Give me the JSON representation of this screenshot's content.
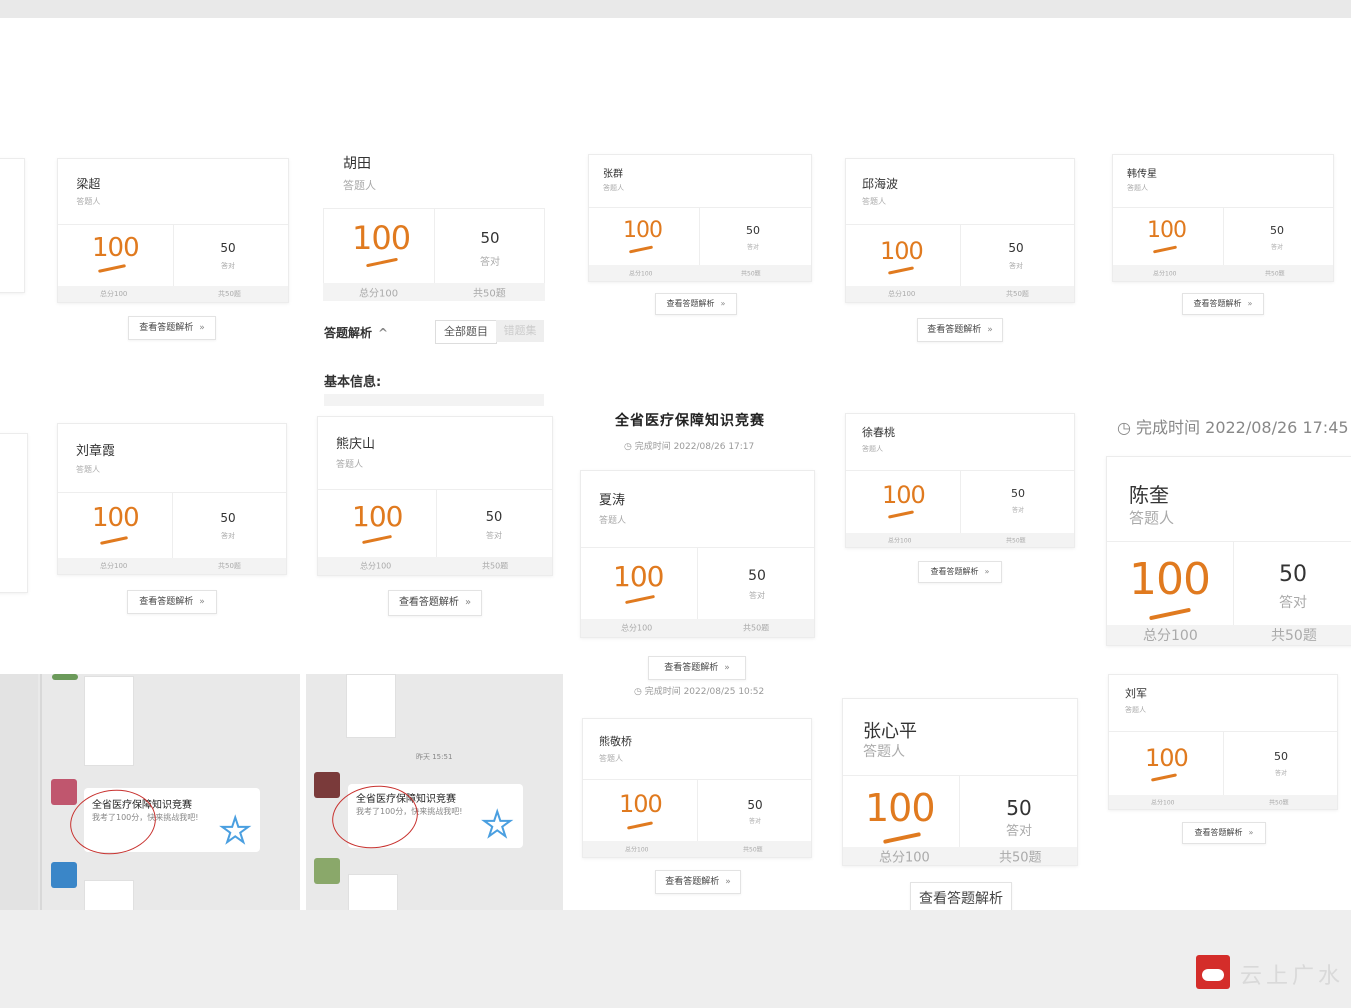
{
  "cards": {
    "liangchao": {
      "name": "梁超",
      "role": "答题人",
      "score": "100",
      "correct": "50",
      "correct_label": "答对",
      "total": "总分100",
      "count": "共50题",
      "button": "查看答题解析"
    },
    "hutian": {
      "name": "胡田",
      "role": "答题人",
      "score": "100",
      "correct": "50",
      "correct_label": "答对",
      "total": "总分100",
      "count": "共50题"
    },
    "zhangqun": {
      "name": "张群",
      "role": "答题人",
      "score": "100",
      "correct": "50",
      "correct_label": "答对",
      "total": "总分100",
      "count": "共50题",
      "button": "查看答题解析"
    },
    "qiuhaibo": {
      "name": "邱海波",
      "role": "答题人",
      "score": "100",
      "correct": "50",
      "correct_label": "答对",
      "total": "总分100",
      "count": "共50题",
      "button": "查看答题解析"
    },
    "hanchuanxing": {
      "name": "韩传星",
      "role": "答题人",
      "score": "100",
      "correct": "50",
      "correct_label": "答对",
      "total": "总分100",
      "count": "共50题",
      "button": "查看答题解析"
    },
    "liuzhangxia": {
      "name": "刘章霞",
      "role": "答题人",
      "score": "100",
      "correct": "50",
      "correct_label": "答对",
      "total": "总分100",
      "count": "共50题",
      "button": "查看答题解析"
    },
    "xiongqingshan": {
      "name": "熊庆山",
      "role": "答题人",
      "score": "100",
      "correct": "50",
      "correct_label": "答对",
      "total": "总分100",
      "count": "共50题",
      "button": "查看答题解析"
    },
    "xiatao": {
      "name": "夏涛",
      "role": "答题人",
      "score": "100",
      "correct": "50",
      "correct_label": "答对",
      "total": "总分100",
      "count": "共50题",
      "button": "查看答题解析"
    },
    "xuchuntao": {
      "name": "徐春桃",
      "role": "答题人",
      "score": "100",
      "correct": "50",
      "correct_label": "答对",
      "total": "总分100",
      "count": "共50题",
      "button": "查看答题解析"
    },
    "chenkui": {
      "name": "陈奎",
      "role": "答题人",
      "score": "100",
      "correct": "50",
      "correct_label": "答对",
      "total": "总分100",
      "count": "共50题"
    },
    "xiongjingqiao": {
      "name": "熊敬桥",
      "role": "答题人",
      "score": "100",
      "correct": "50",
      "correct_label": "答对",
      "total": "总分100",
      "count": "共50题",
      "button": "查看答题解析"
    },
    "zhangxinping": {
      "name": "张心平",
      "role": "答题人",
      "score": "100",
      "correct": "50",
      "correct_label": "答对",
      "total": "总分100",
      "count": "共50题",
      "button": "查看答题解析"
    },
    "liujun": {
      "name": "刘军",
      "role": "答题人",
      "score": "100",
      "correct": "50",
      "correct_label": "答对",
      "total": "总分100",
      "count": "共50题",
      "button": "查看答题解析"
    }
  },
  "hutian_extra": {
    "analysis_label": "答题解析",
    "tab_all": "全部题目",
    "tab_wrong": "错题集",
    "basic_info": "基本信息:"
  },
  "contest_title": "全省医疗保障知识竞赛",
  "times": {
    "xiatao": "完成时间  2022/08/26 17:17",
    "chenkui": "完成时间  2022/08/26 17:45",
    "xiongjingqiao": "完成时间  2022/08/25 10:52"
  },
  "chat1": {
    "share_title": "全省医疗保障知识竞赛",
    "share_desc": "我考了100分，快来挑战我吧!"
  },
  "chat2": {
    "time": "昨天 15:51",
    "share_title": "全省医疗保障知识竞赛",
    "share_desc": "我考了100分，快来挑战我吧!"
  },
  "colors": {
    "accent": "#e07a1f",
    "circle": "#c8322f",
    "logo": "#d42d2a"
  }
}
